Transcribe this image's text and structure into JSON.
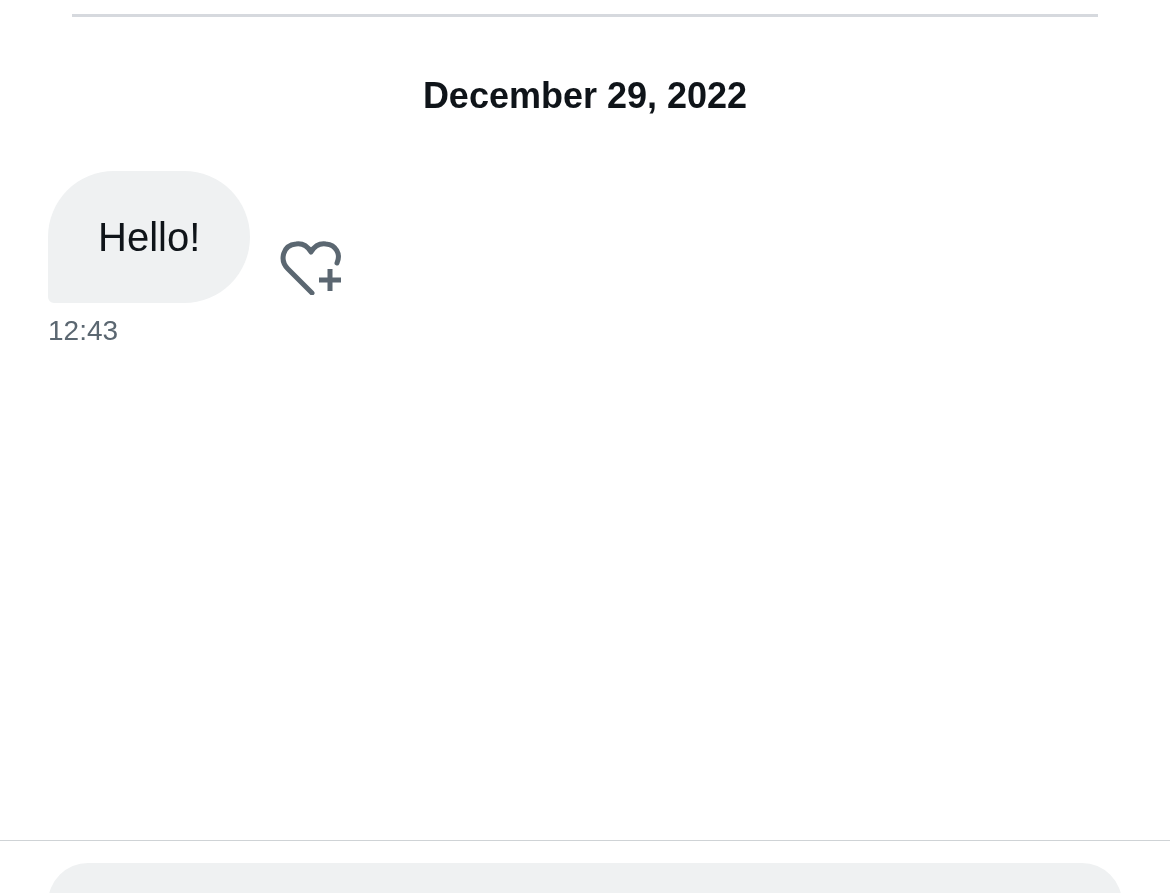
{
  "date_header": "December 29, 2022",
  "messages": [
    {
      "text": "Hello!",
      "time": "12:43"
    }
  ]
}
